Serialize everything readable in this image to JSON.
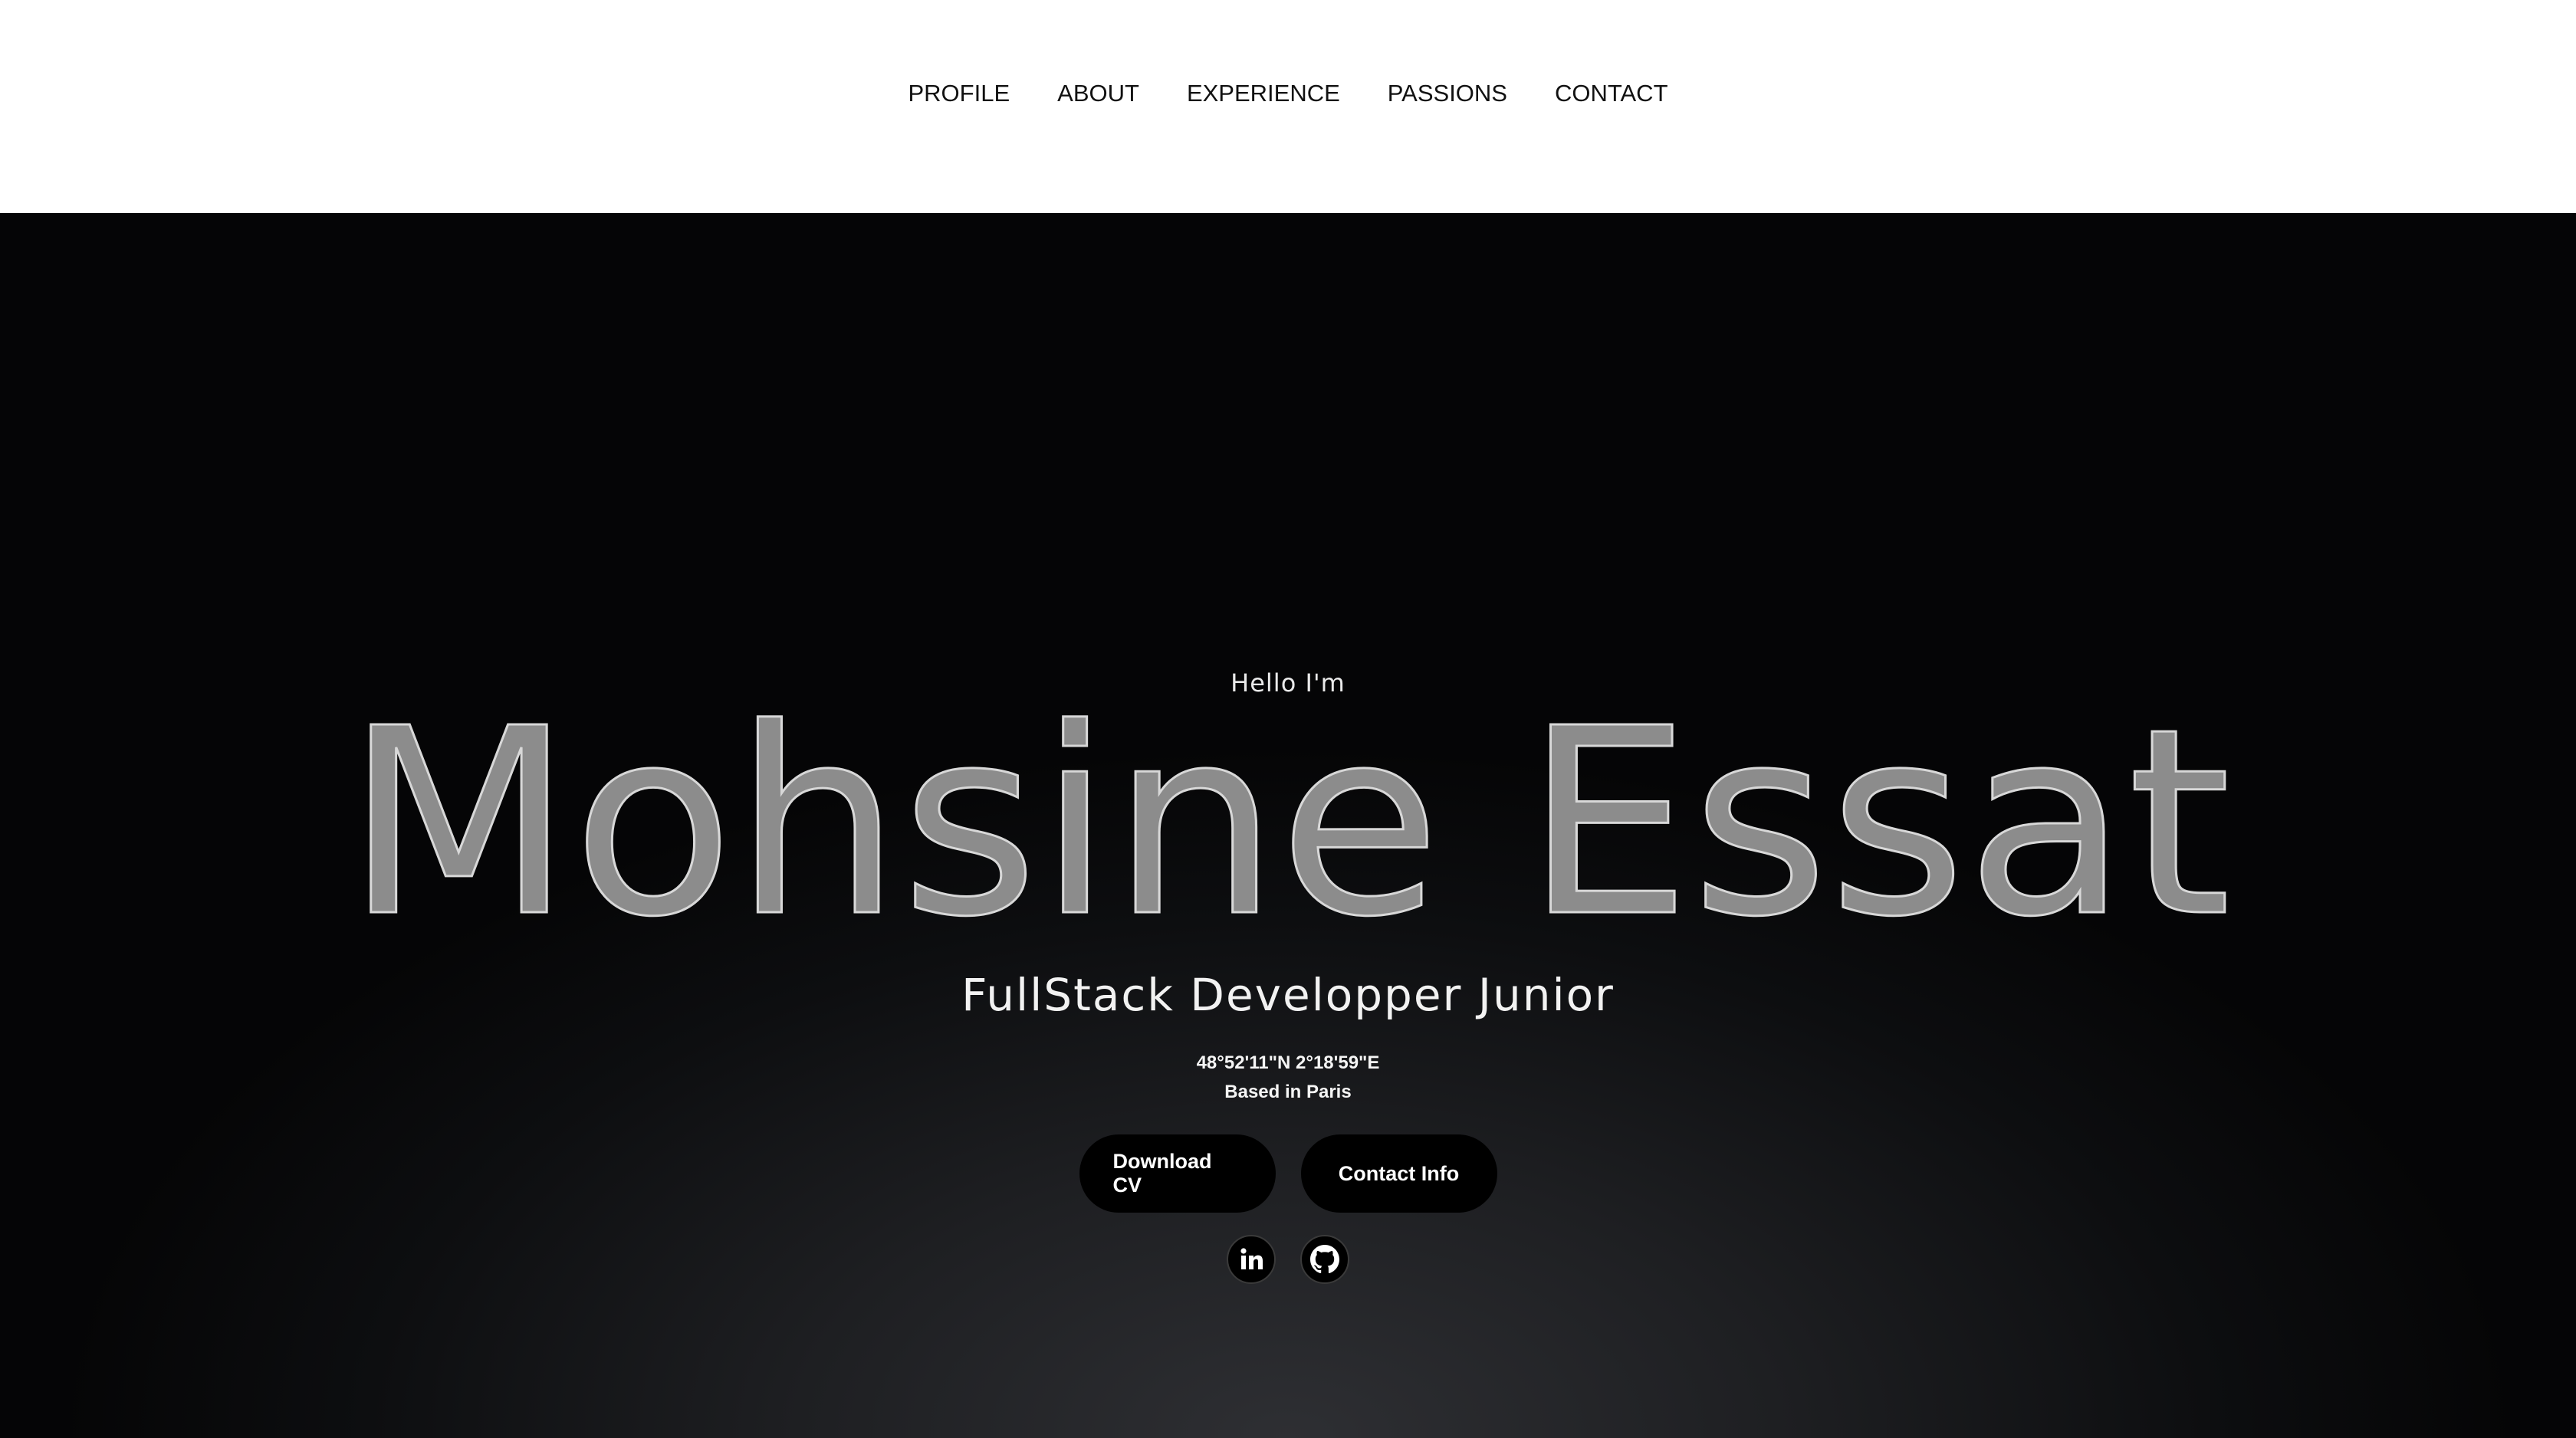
{
  "nav": {
    "items": [
      {
        "label": "PROFILE"
      },
      {
        "label": "ABOUT"
      },
      {
        "label": "EXPERIENCE"
      },
      {
        "label": "PASSIONS"
      },
      {
        "label": "CONTACT"
      }
    ]
  },
  "hero": {
    "greeting": "Hello I'm",
    "name": "Mohsine Essat",
    "role": "FullStack Developper Junior",
    "coordinates": "48°52'11\"N 2°18'59\"E",
    "location": "Based in Paris",
    "download_cv_label": "Download CV",
    "contact_info_label": "Contact Info",
    "socials": [
      {
        "icon": "linkedin-icon"
      },
      {
        "icon": "github-icon"
      }
    ]
  },
  "colors": {
    "hero_background": "#0d0e10",
    "name_fill": "#8c8c8c",
    "name_stroke": "#d8d8d8",
    "button_background": "#000000"
  }
}
